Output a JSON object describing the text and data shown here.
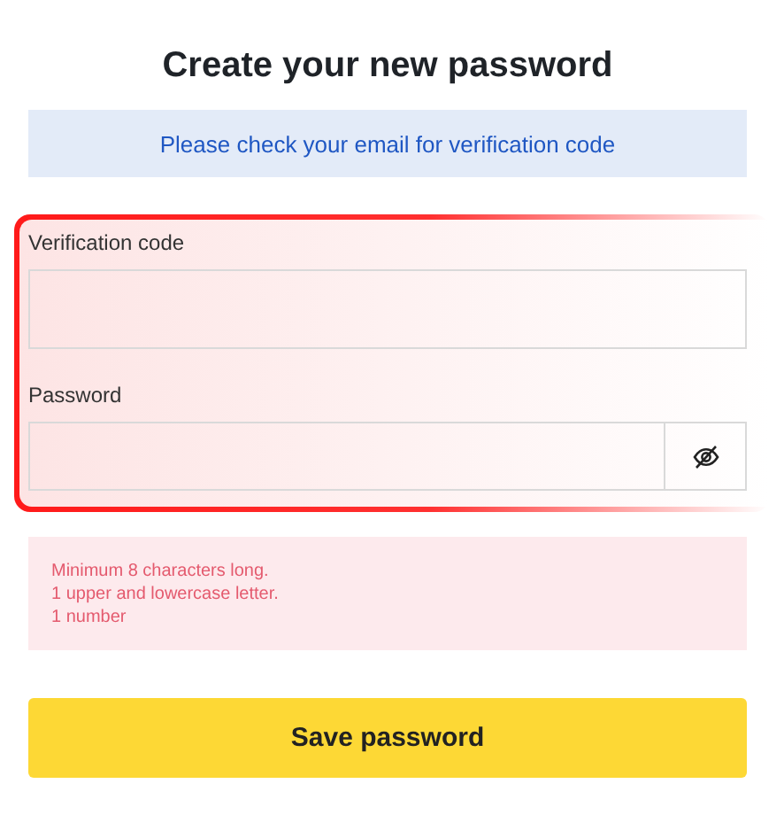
{
  "title": "Create your new password",
  "notice": "Please check your email for verification code",
  "fields": [
    {
      "label": "Verification code",
      "kind": "text"
    },
    {
      "label": "Password",
      "kind": "password"
    }
  ],
  "rules": [
    "Minimum 8 characters long.",
    "1 upper and lowercase letter.",
    "1 number"
  ],
  "button": "Save password"
}
